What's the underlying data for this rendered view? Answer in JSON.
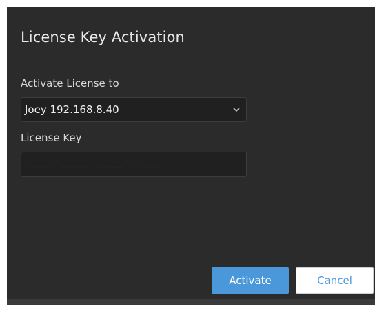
{
  "dialog": {
    "title": "License Key Activation",
    "activate_to_label": "Activate License to",
    "activate_to_value": "Joey 192.168.8.40",
    "license_key_label": "License Key",
    "license_key_mask": "____-____-____-____",
    "activate_label": "Activate",
    "cancel_label": "Cancel"
  },
  "colors": {
    "dialog_bg": "#2b2b2b",
    "field_bg": "#202020",
    "accent": "#4a97d9"
  },
  "icons": {
    "select_chevron": "chevron-down-icon"
  }
}
